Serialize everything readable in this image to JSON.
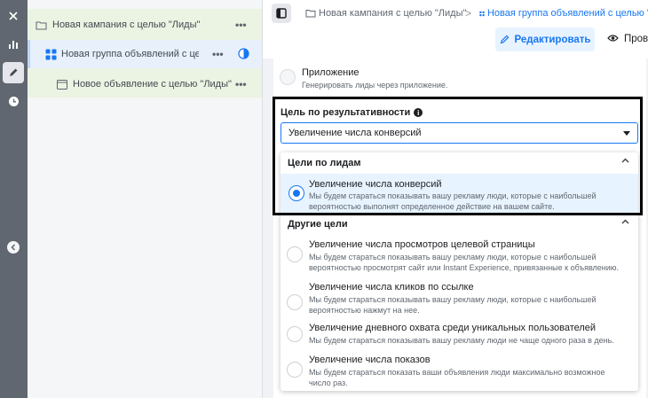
{
  "rail": {
    "close_icon": "close-icon",
    "chart_icon": "bar-chart-icon",
    "edit_icon": "pencil-icon",
    "history_icon": "clock-icon",
    "collapse_icon": "chevron-left-icon"
  },
  "tree": {
    "campaign": {
      "label": "Новая кампания с целью \"Лиды\"",
      "more": "•••"
    },
    "adset": {
      "label": "Новая группа объявлений с це...",
      "more": "•••"
    },
    "ad": {
      "label": "Новое объявление с целью \"Лиды\"",
      "more": "•••"
    }
  },
  "breadcrumb": {
    "campaign": "Новая кампания с целью \"Лиды\"",
    "separator": ">",
    "adset": "Новая группа объявлений с целью \"Л"
  },
  "toolbar": {
    "edit_label": "Редактировать",
    "preview_label": "Прове"
  },
  "app_option": {
    "title": "Приложение",
    "desc": "Генерировать лиды через приложение."
  },
  "goal": {
    "label": "Цель по результативности",
    "selected": "Увеличение числа конверсий"
  },
  "dropdown": {
    "group1": {
      "title": "Цели по лидам",
      "options": [
        {
          "title": "Увеличение числа конверсий",
          "desc": "Мы будем стараться показывать вашу рекламу люди, которые с наибольшей вероятностью выполнят определенное действие на вашем сайте."
        }
      ]
    },
    "group2": {
      "title": "Другие цели",
      "options": [
        {
          "title": "Увеличение числа просмотров целевой страницы",
          "desc": "Мы будем стараться показывать вашу рекламу люди, которые с наибольшей вероятностью просмотрят сайт или Instant Experience, привязанные к объявлению."
        },
        {
          "title": "Увеличение числа кликов по ссылке",
          "desc": "Мы будем стараться показывать вашу рекламу люди, которые с наибольшей вероятностью нажмут на нее."
        },
        {
          "title": "Увеличение дневного охвата среди уникальных пользователей",
          "desc": "Мы будем стараться показывать вашу рекламу люди не чаще одного раза в день."
        },
        {
          "title": "Увеличение числа показов",
          "desc": "Мы будем стараться показать ваши объявления люди максимально возможное число раз."
        }
      ]
    }
  },
  "colors": {
    "accent": "#1877f2",
    "rail": "#606770",
    "tree_highlight": "#ebf3e3"
  }
}
